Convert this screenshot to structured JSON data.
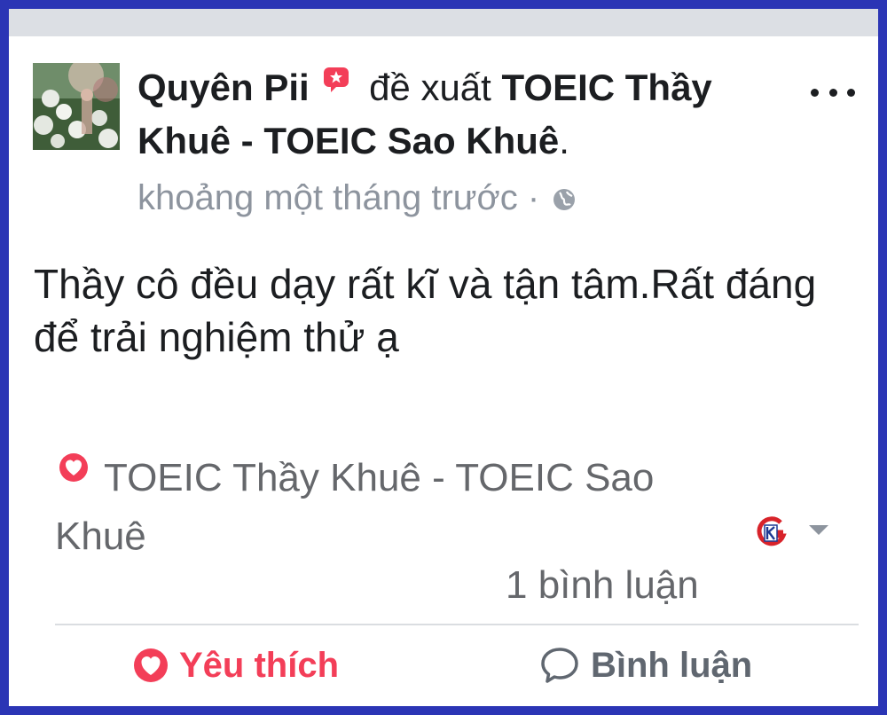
{
  "post": {
    "author": "Quyên Pii",
    "recommends_text": "đề xuất",
    "page_name_line1": "TOEIC Thầy",
    "page_name_line2": "Khuê - TOEIC Sao Khuê",
    "period": ".",
    "timestamp": "khoảng một tháng trước ·",
    "review_text": "Thầy cô đều dạy rất kĩ và tận tâm.Rất đáng để trải nghiệm thử ạ",
    "recommended_page": "TOEIC Thầy Khuê - TOEIC Sao Khuê",
    "comment_count": "1 bình luận"
  },
  "actions": {
    "like_label": "Yêu thích",
    "comment_label": "Bình luận"
  },
  "icons": {
    "badge": "star-badge-icon",
    "privacy": "globe-icon",
    "more": "more-options-icon",
    "recommend": "heart-icon",
    "like": "heart-icon",
    "comment": "comment-bubble-icon",
    "page_logo": "toeic-sao-khue-logo"
  },
  "colors": {
    "frame": "#2b35b5",
    "accent_red": "#f33e58",
    "text_primary": "#1c1e21",
    "text_secondary": "#65676b"
  }
}
